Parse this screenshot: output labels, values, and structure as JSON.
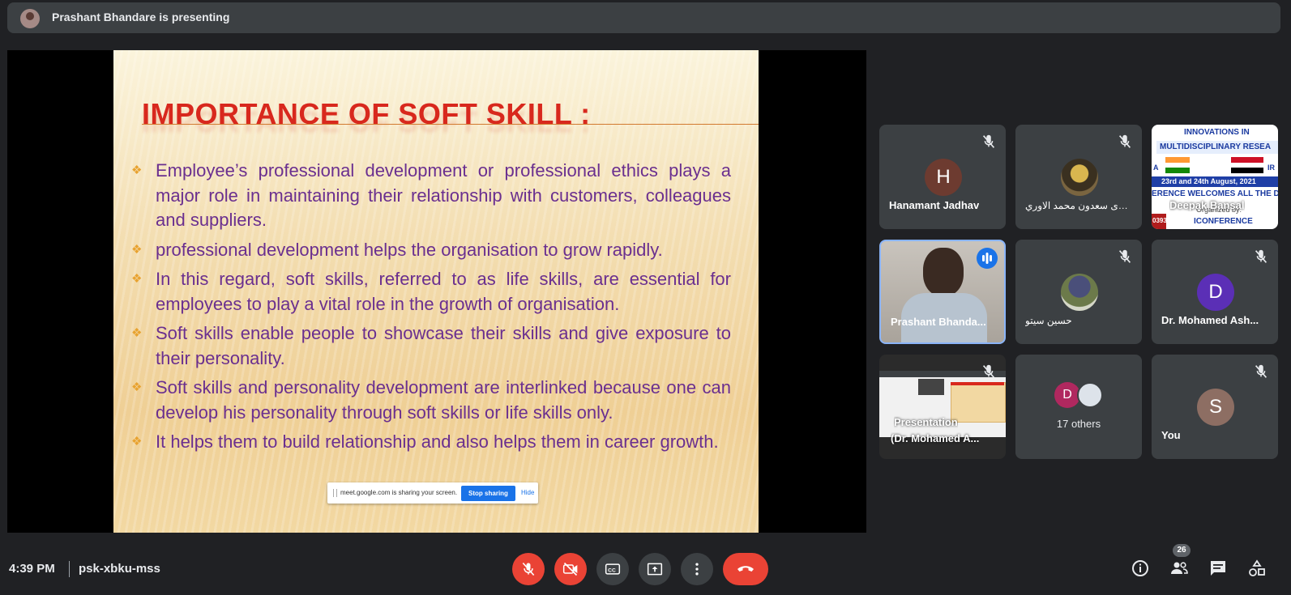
{
  "header": {
    "presenter_text": "Prashant Bhandare is presenting"
  },
  "slide": {
    "title": "IMPORTANCE OF SOFT SKILL :",
    "bullets": [
      "Employee’s professional development or professional ethics plays a major role in maintaining their relationship with customers, colleagues and suppliers.",
      "professional development helps the organisation to grow rapidly.",
      "In this regard, soft skills, referred to as life skills, are essential for employees to play a vital role in the growth of organisation.",
      "Soft skills enable people to showcase their skills and give exposure to their personality.",
      "Soft skills and personality development are interlinked because one can develop his personality through soft skills or life skills only.",
      "It helps them to build relationship and also helps them in career growth."
    ]
  },
  "share_bar": {
    "message": "meet.google.com is sharing your screen.",
    "stop_label": "Stop sharing",
    "hide_label": "Hide"
  },
  "participants": [
    {
      "name": "Hanamant Jadhav",
      "initial": "H",
      "avatar_color": "#6d3b30",
      "muted": true
    },
    {
      "name": "بشری سعدون محمد الاوري",
      "initial": "",
      "avatar_color": "#7a6540",
      "muted": true
    },
    {
      "name": "Deepak Bansal",
      "muted": false,
      "banner": {
        "line1": "INNOVATIONS IN",
        "line2": "MULTIDISCIPLINARY RESEA",
        "line3": "23rd and 24th August, 2021",
        "line4": "ERENCE WELCOMES ALL THE DEL",
        "line5": "ICONFERENCE",
        "prefix_left": "A",
        "prefix_right": "IR",
        "code": "0393",
        "org": "Organized by:"
      }
    },
    {
      "name": "Prashant Bhanda...",
      "muted": false,
      "speaking": true
    },
    {
      "name": "حسین سیتو",
      "initial": "",
      "avatar_color": "#4a5a3a",
      "muted": true
    },
    {
      "name": "Dr. Mohamed Ash...",
      "initial": "D",
      "avatar_color": "#5b2fb6",
      "muted": true
    },
    {
      "name_line1": "Presentation",
      "name_line2": "(Dr. Mohamed A...",
      "muted": true
    },
    {
      "name": "17 others",
      "initial": "D",
      "avatar_color": "#b0285f"
    },
    {
      "name": "You",
      "initial": "S",
      "avatar_color": "#8d6e63",
      "muted": true
    }
  ],
  "footer": {
    "time": "4:39 PM",
    "meeting_code": "psk-xbku-mss",
    "participant_count": "26"
  },
  "colors": {
    "accent_red": "#ea4335",
    "active_border": "#8ab4f8",
    "speaking_blue": "#1a73e8"
  }
}
